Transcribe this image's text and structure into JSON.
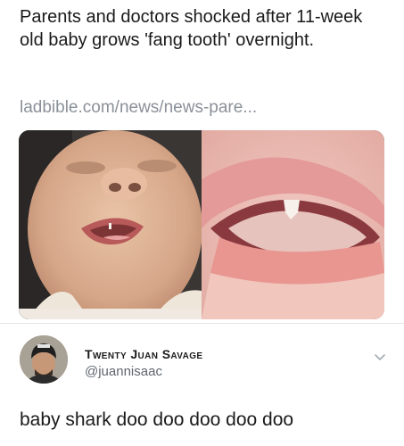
{
  "post": {
    "headline": "Parents and doctors shocked after 11-week old baby grows 'fang tooth' overnight.",
    "link_text": "ladbible.com/news/news-pare..."
  },
  "media": {
    "left_image": "baby-face-photo",
    "right_image": "baby-mouth-closeup-photo"
  },
  "reply": {
    "display_name": "Twenty Juan Savage",
    "handle": "@juannisaac",
    "text": "baby shark doo doo doo doo doo"
  },
  "icons": {
    "more_options": "chevron-down-icon"
  },
  "colors": {
    "link": "#8a9199",
    "handle": "#5f6770",
    "text": "#1a1a1a"
  }
}
